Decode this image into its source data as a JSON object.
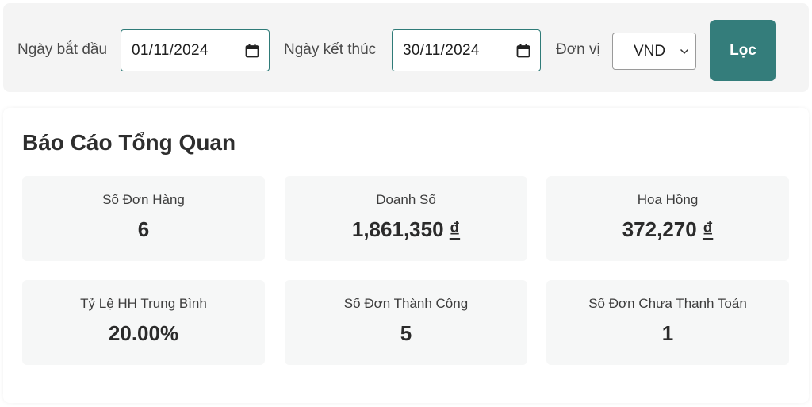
{
  "filters": {
    "start_label": "Ngày bắt đầu",
    "start_value": "01/11/2024",
    "end_label": "Ngày kết thúc",
    "end_value": "30/11/2024",
    "unit_label": "Đơn vị",
    "unit_value": "VND",
    "submit_label": "Lọc",
    "accent_color": "#347d7b"
  },
  "report": {
    "title": "Báo Cáo Tổng Quan",
    "stats": [
      {
        "label": "Số Đơn Hàng",
        "value": "6"
      },
      {
        "label": "Doanh Số",
        "value": "1,861,350",
        "currency": "₫"
      },
      {
        "label": "Hoa Hồng",
        "value": "372,270",
        "currency": "₫"
      },
      {
        "label": "Tỷ Lệ HH Trung Bình",
        "value": "20.00%"
      },
      {
        "label": "Số Đơn Thành Công",
        "value": "5"
      },
      {
        "label": "Số Đơn Chưa Thanh Toán",
        "value": "1"
      }
    ]
  }
}
